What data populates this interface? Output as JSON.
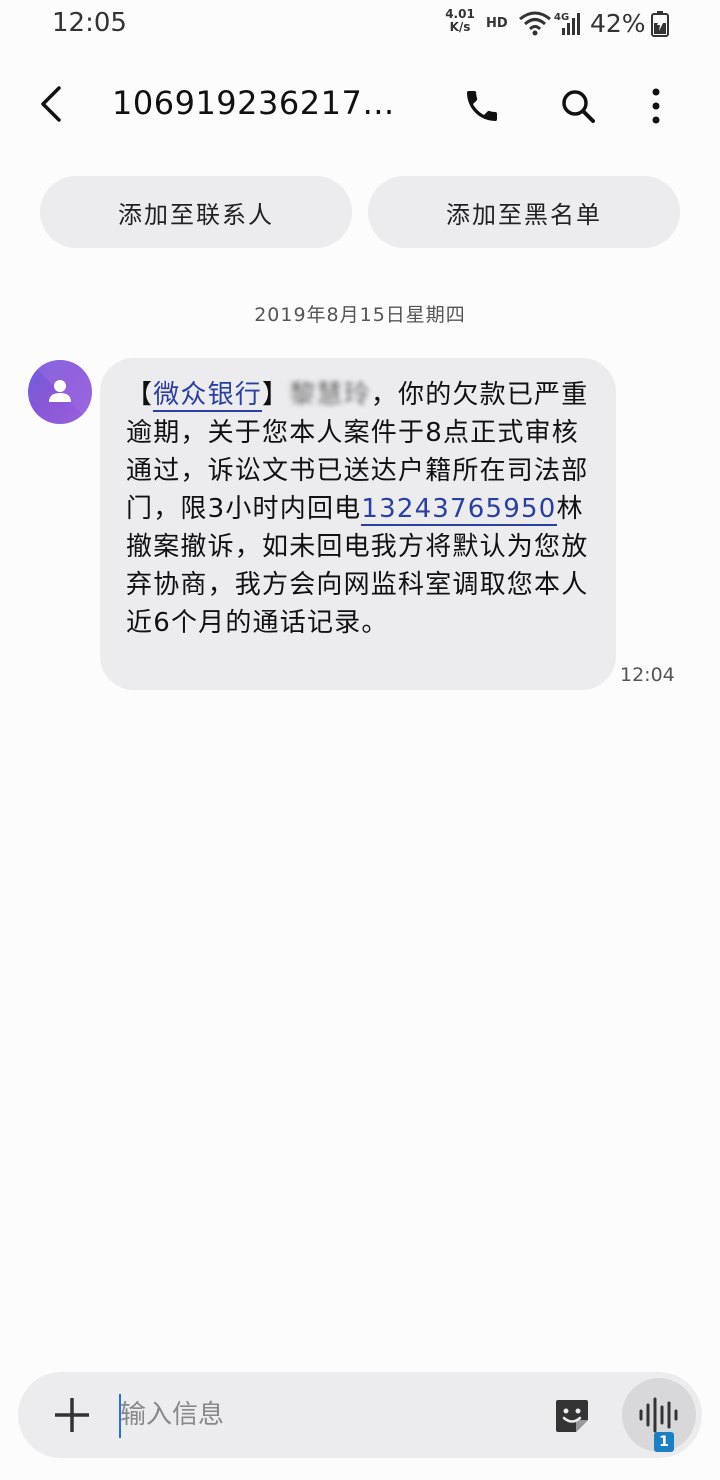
{
  "status_bar": {
    "time": "12:05",
    "net_speed_value": "4.01",
    "net_speed_unit": "K/s",
    "hd_label": "HD",
    "network_label": "4G",
    "battery_percent": "42%"
  },
  "header": {
    "title": "106919236217…",
    "icons": [
      "back-icon",
      "phone-icon",
      "search-icon",
      "more-vertical-icon"
    ]
  },
  "actions": {
    "add_contact": "添加至联系人",
    "add_blacklist": "添加至黑名单"
  },
  "conversation": {
    "date": "2019年8月15日星期四",
    "message": {
      "open_bracket": "【",
      "bank_link": "微众银行",
      "close_bracket": "】",
      "redacted_name": "黎慧玲",
      "body_part1": "，你的欠款已严重逾期，关于您本人案件于8点正式审核通过，诉讼文书已送达户籍所在司法部门，限3小时内回电",
      "phone_link": "13243765950",
      "body_part2": "林撤案撤诉，如未回电我方将默认为您放弃协商，我方会向网监科室调取您本人近6个月的通话记录。",
      "time": "12:04"
    }
  },
  "compose": {
    "placeholder": "输入信息",
    "sim_badge": "1"
  },
  "colors": {
    "accent_link": "#2a3f9e",
    "avatar_gradient_start": "#6d5fd9",
    "avatar_gradient_end": "#9b62e0",
    "bubble_bg": "#ececee",
    "sim_badge": "#1d7fc3"
  }
}
